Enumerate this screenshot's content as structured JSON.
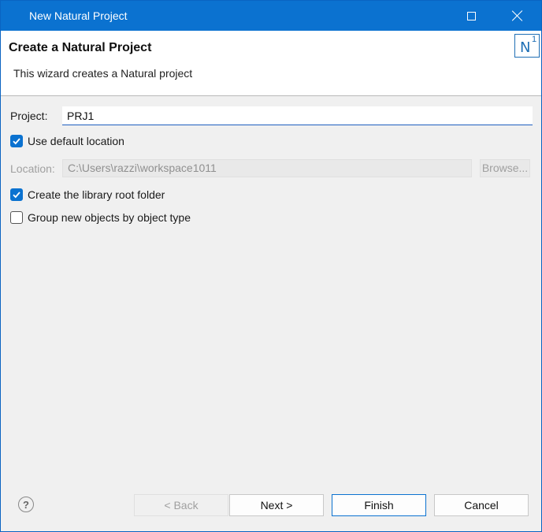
{
  "window": {
    "title": "New Natural Project"
  },
  "banner": {
    "title": "Create a Natural Project",
    "description": "This wizard creates a Natural project",
    "logo_letter": "N",
    "logo_superscript": "1"
  },
  "form": {
    "project_label": "Project:",
    "project_value": "PRJ1",
    "use_default_location": {
      "label": "Use default location",
      "checked": true
    },
    "location_label": "Location:",
    "location_value": "C:\\Users\\razzi\\workspace1011",
    "browse_label": "Browse...",
    "create_library_root": {
      "label": "Create the library root folder",
      "checked": true
    },
    "group_by_type": {
      "label": "Group new objects by object type",
      "checked": false
    }
  },
  "buttons": {
    "help": "?",
    "back": "< Back",
    "next": "Next >",
    "finish": "Finish",
    "cancel": "Cancel"
  },
  "colors": {
    "accent": "#0b72d0",
    "title_bar": "#0b72d0"
  }
}
